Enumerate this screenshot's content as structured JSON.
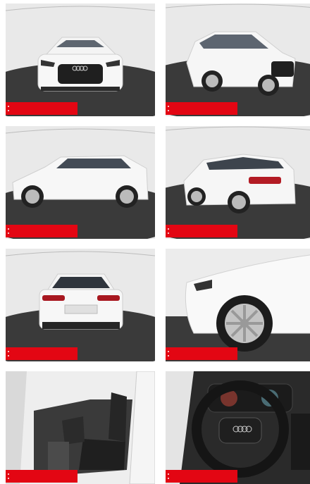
{
  "gallery": {
    "badge_color": "#e30613",
    "tiles": [
      {
        "id": "front-view",
        "icon": "car-front-photo"
      },
      {
        "id": "front-three-quarter-view",
        "icon": "car-three-quarter-photo"
      },
      {
        "id": "side-view",
        "icon": "car-side-photo"
      },
      {
        "id": "rear-three-quarter-view",
        "icon": "car-rear-three-quarter-photo"
      },
      {
        "id": "rear-view",
        "icon": "car-rear-photo"
      },
      {
        "id": "wheel-closeup",
        "icon": "car-wheel-photo"
      },
      {
        "id": "interior-front-seats",
        "icon": "car-seats-photo"
      },
      {
        "id": "interior-steering-wheel",
        "icon": "steering-wheel-photo"
      }
    ]
  }
}
